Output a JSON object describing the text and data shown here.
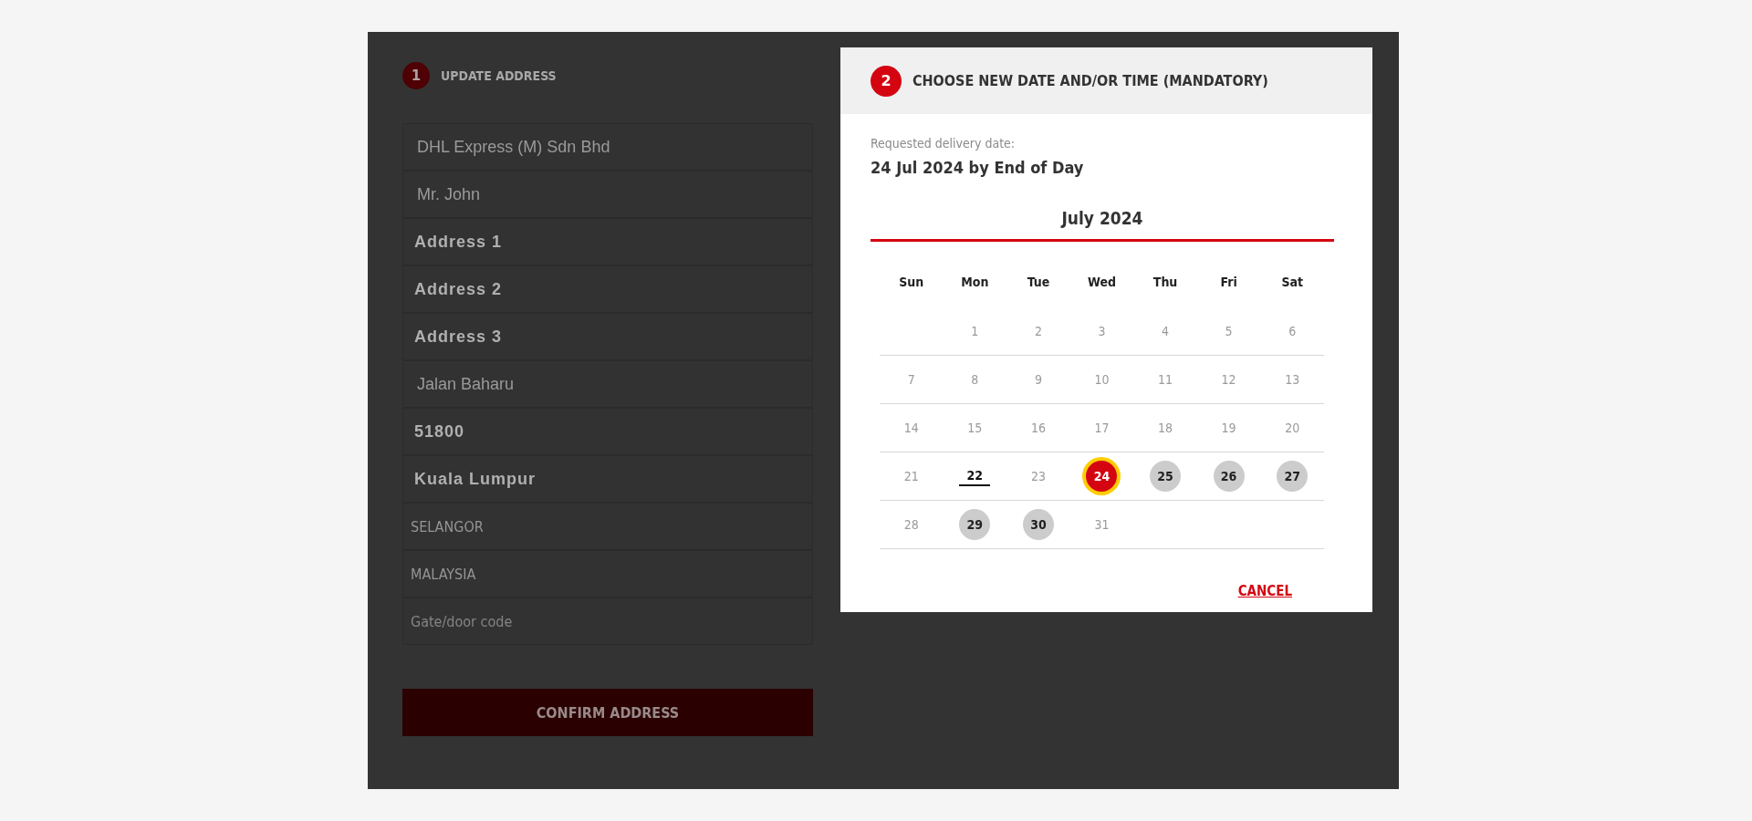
{
  "address_step": {
    "number": "1",
    "title": "UPDATE ADDRESS"
  },
  "fields": [
    {
      "kind": "plain",
      "value": "DHL Express (M) Sdn Bhd"
    },
    {
      "kind": "plain",
      "value": "Mr. John"
    },
    {
      "kind": "strong",
      "value": "Address 1"
    },
    {
      "kind": "strong",
      "value": "Address 2"
    },
    {
      "kind": "strong",
      "value": "Address 3"
    },
    {
      "kind": "plain",
      "value": "Jalan Baharu"
    },
    {
      "kind": "strong",
      "value": "51800"
    },
    {
      "kind": "strong",
      "value": "Kuala Lumpur"
    },
    {
      "kind": "condensed",
      "value": "SELANGOR"
    },
    {
      "kind": "condensed",
      "value": "MALAYSIA"
    },
    {
      "kind": "condensed",
      "placeholder": "Gate/door code"
    }
  ],
  "confirm_button": "CONFIRM ADDRESS",
  "dialog": {
    "number": "2",
    "title": "CHOOSE NEW DATE AND/OR TIME (MANDATORY)",
    "requested_label": "Requested delivery date:",
    "requested_value": "24 Jul 2024 by End of Day",
    "month": "July 2024",
    "weekdays": [
      "Sun",
      "Mon",
      "Tue",
      "Wed",
      "Thu",
      "Fri",
      "Sat"
    ],
    "weeks": [
      [
        {
          "kind": "empty"
        },
        {
          "kind": "day",
          "label": "1",
          "available": false,
          "today": false,
          "selected": false
        },
        {
          "kind": "day",
          "label": "2",
          "available": false,
          "today": false,
          "selected": false
        },
        {
          "kind": "day",
          "label": "3",
          "available": false,
          "today": false,
          "selected": false
        },
        {
          "kind": "day",
          "label": "4",
          "available": false,
          "today": false,
          "selected": false
        },
        {
          "kind": "day",
          "label": "5",
          "available": false,
          "today": false,
          "selected": false
        },
        {
          "kind": "day",
          "label": "6",
          "available": false,
          "today": false,
          "selected": false
        }
      ],
      [
        {
          "kind": "day",
          "label": "7",
          "available": false,
          "today": false,
          "selected": false
        },
        {
          "kind": "day",
          "label": "8",
          "available": false,
          "today": false,
          "selected": false
        },
        {
          "kind": "day",
          "label": "9",
          "available": false,
          "today": false,
          "selected": false
        },
        {
          "kind": "day",
          "label": "10",
          "available": false,
          "today": false,
          "selected": false
        },
        {
          "kind": "day",
          "label": "11",
          "available": false,
          "today": false,
          "selected": false
        },
        {
          "kind": "day",
          "label": "12",
          "available": false,
          "today": false,
          "selected": false
        },
        {
          "kind": "day",
          "label": "13",
          "available": false,
          "today": false,
          "selected": false
        }
      ],
      [
        {
          "kind": "day",
          "label": "14",
          "available": false,
          "today": false,
          "selected": false
        },
        {
          "kind": "day",
          "label": "15",
          "available": false,
          "today": false,
          "selected": false
        },
        {
          "kind": "day",
          "label": "16",
          "available": false,
          "today": false,
          "selected": false
        },
        {
          "kind": "day",
          "label": "17",
          "available": false,
          "today": false,
          "selected": false
        },
        {
          "kind": "day",
          "label": "18",
          "available": false,
          "today": false,
          "selected": false
        },
        {
          "kind": "day",
          "label": "19",
          "available": false,
          "today": false,
          "selected": false
        },
        {
          "kind": "day",
          "label": "20",
          "available": false,
          "today": false,
          "selected": false
        }
      ],
      [
        {
          "kind": "day",
          "label": "21",
          "available": false,
          "today": false,
          "selected": false
        },
        {
          "kind": "day",
          "label": "22",
          "available": false,
          "today": true,
          "selected": false
        },
        {
          "kind": "day",
          "label": "23",
          "available": false,
          "today": false,
          "selected": false
        },
        {
          "kind": "day",
          "label": "24",
          "available": true,
          "today": false,
          "selected": true
        },
        {
          "kind": "day",
          "label": "25",
          "available": true,
          "today": false,
          "selected": false
        },
        {
          "kind": "day",
          "label": "26",
          "available": true,
          "today": false,
          "selected": false
        },
        {
          "kind": "day",
          "label": "27",
          "available": true,
          "today": false,
          "selected": false
        }
      ],
      [
        {
          "kind": "day",
          "label": "28",
          "available": false,
          "today": false,
          "selected": false
        },
        {
          "kind": "day",
          "label": "29",
          "available": true,
          "today": false,
          "selected": false
        },
        {
          "kind": "day",
          "label": "30",
          "available": true,
          "today": false,
          "selected": false
        },
        {
          "kind": "day",
          "label": "31",
          "available": false,
          "today": false,
          "selected": false
        },
        {
          "kind": "empty"
        },
        {
          "kind": "empty"
        },
        {
          "kind": "empty"
        }
      ]
    ],
    "cancel": "CANCEL"
  }
}
